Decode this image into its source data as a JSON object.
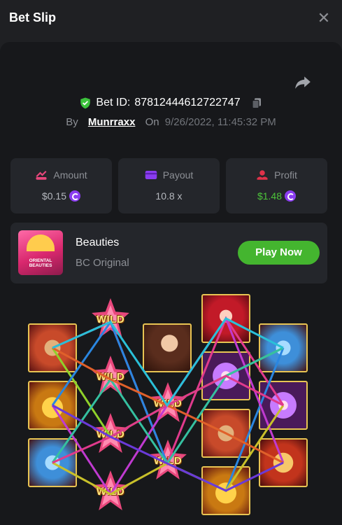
{
  "header": {
    "title": "Bet Slip"
  },
  "bet": {
    "id_label": "Bet ID:",
    "id": "87812444612722747",
    "by_label": "By",
    "user": "Munrraxx",
    "on_label": "On",
    "date": "9/26/2022, 11:45:32 PM"
  },
  "stats": {
    "amount": {
      "label": "Amount",
      "value": "$0.15"
    },
    "payout": {
      "label": "Payout",
      "value": "10.8 x"
    },
    "profit": {
      "label": "Profit",
      "value": "$1.48"
    }
  },
  "game": {
    "name": "Beauties",
    "provider": "BC Original",
    "play_label": "Play Now",
    "thumb_text": "ORIENTAL BEAUTIES"
  },
  "reels": {
    "wild_text": "WILD",
    "columns": [
      [
        "fan",
        "gold",
        "crystal"
      ],
      [
        "wild",
        "wild",
        "wild",
        "wild"
      ],
      [
        "lady",
        "wild",
        "wild"
      ],
      [
        "redlady",
        "mask",
        "fan",
        "gold"
      ],
      [
        "crystal",
        "mask",
        "comb"
      ]
    ]
  },
  "colors": {
    "accent_green": "#44b52f",
    "profit_green": "#4dc53a",
    "coin_purple": "#8a3cf0",
    "amount_icon": "#e8477c",
    "payout_icon": "#8a3cf0",
    "profit_icon": "#e0324a",
    "tile_border": "#e8c453"
  },
  "icons": {
    "close": "close-icon",
    "share": "share-icon",
    "shield": "shield-check-icon",
    "copy": "copy-icon",
    "coin": "coin-icon"
  }
}
